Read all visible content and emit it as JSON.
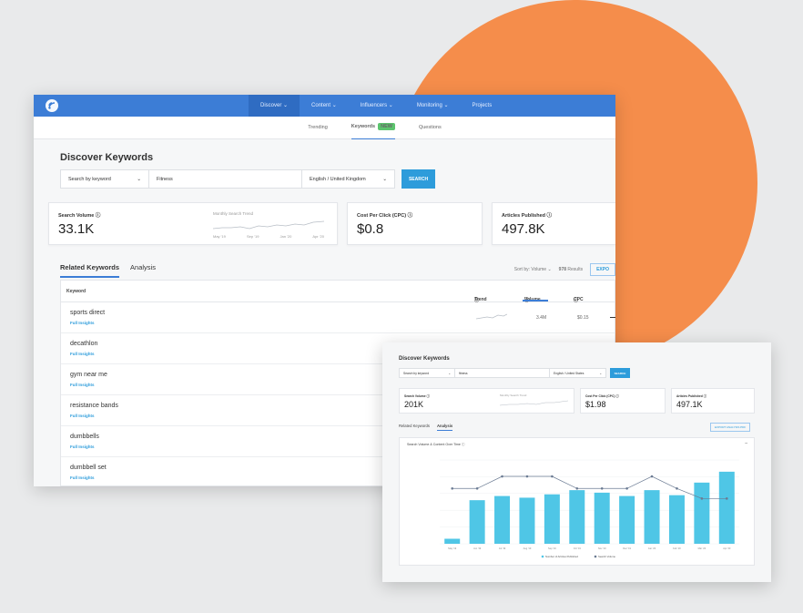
{
  "app": {
    "nav": [
      "Discover",
      "Content",
      "Influencers",
      "Monitoring",
      "Projects"
    ],
    "subnav": [
      "Trending",
      "Keywords",
      "Questions"
    ],
    "subnav_badge": "NEW",
    "accent": "#3c7dd6",
    "decoration_color": "#f58d4b"
  },
  "main": {
    "title": "Discover Keywords",
    "search": {
      "mode": "Search by keyword",
      "query": "Fitness",
      "locale": "English / United Kingdom",
      "button": "SEARCH"
    },
    "cards": {
      "volume_label": "Search Volume",
      "volume_value": "33.1K",
      "trend_label": "Monthly Search Trend",
      "trend_axis": [
        "May '19",
        "Sep '19",
        "Jan '20",
        "Apr '20"
      ],
      "cpc_label": "Cost Per Click (CPC)",
      "cpc_value": "$0.8",
      "articles_label": "Articles Published",
      "articles_value": "497.8K"
    },
    "tabs": [
      "Related Keywords",
      "Analysis"
    ],
    "sort": {
      "label": "Sort by: Volume",
      "count": "978",
      "results_label": "Results",
      "export": "EXPO"
    },
    "table": {
      "headers": {
        "keyword": "Keyword",
        "trend": "Trend",
        "volume": "Volume",
        "cpc": "CPC"
      },
      "insight_label": "Full Insights",
      "rows": [
        {
          "keyword": "sports direct",
          "volume": "3.4M",
          "cpc": "$0.15"
        },
        {
          "keyword": "decathlon",
          "volume": "",
          "cpc": ""
        },
        {
          "keyword": "gym near me",
          "volume": "",
          "cpc": ""
        },
        {
          "keyword": "resistance bands",
          "volume": "",
          "cpc": ""
        },
        {
          "keyword": "dumbbells",
          "volume": "",
          "cpc": ""
        },
        {
          "keyword": "dumbbell set",
          "volume": "",
          "cpc": ""
        }
      ]
    }
  },
  "secondary": {
    "title": "Discover Keywords",
    "search": {
      "mode": "Search by keyword",
      "query": "fitness",
      "locale": "English / United States",
      "button": "SEARCH"
    },
    "cards": {
      "volume_label": "Search Volume",
      "volume_value": "201K",
      "trend_label": "Monthly Search Trend",
      "cpc_label": "Cost Per Click (CPC)",
      "cpc_value": "$1.98",
      "articles_label": "Articles Published",
      "articles_value": "497.1K"
    },
    "tabs": [
      "Related Keywords",
      "Analysis"
    ],
    "export": "EXPORT ANALYSIS PDF",
    "chart_title": "Search Volume & Content Over Time"
  },
  "chart_data": {
    "type": "bar",
    "title": "Search Volume & Content Over Time",
    "categories": [
      "May '19",
      "Jun '19",
      "Jul '19",
      "Aug '19",
      "Sep '19",
      "Oct '19",
      "Nov '19",
      "Dec '19",
      "Jan '20",
      "Feb '20",
      "Mar '20",
      "Apr '20"
    ],
    "ylim": [
      0,
      50000
    ],
    "y2lim": [
      0,
      250000
    ],
    "series": [
      {
        "name": "Number of Articles Published",
        "type": "bar",
        "axis": "left",
        "color": "#4fc6e6",
        "values": [
          3000,
          26000,
          28500,
          27500,
          29500,
          32000,
          30500,
          28500,
          32000,
          29000,
          36500,
          43000
        ]
      },
      {
        "name": "Search Volume",
        "type": "line",
        "axis": "right",
        "color": "#6b7b93",
        "values": [
          165000,
          165000,
          201000,
          201000,
          201000,
          165000,
          165000,
          165000,
          201000,
          165000,
          135000,
          135000
        ]
      }
    ]
  }
}
